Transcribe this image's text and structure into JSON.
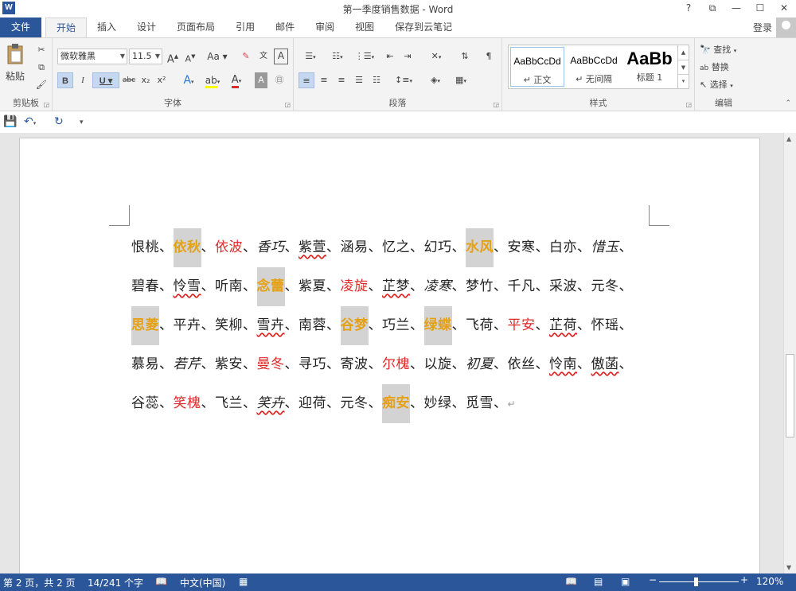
{
  "window": {
    "title": "第一季度销售数据 - Word",
    "controls": [
      "?",
      "⧉",
      "—",
      "☐",
      "✕"
    ]
  },
  "tabs": {
    "file": "文件",
    "items": [
      "开始",
      "插入",
      "设计",
      "页面布局",
      "引用",
      "邮件",
      "审阅",
      "视图",
      "保存到云笔记"
    ],
    "active": "开始",
    "login": "登录"
  },
  "ribbon": {
    "clipboard": {
      "label": "剪贴板",
      "paste": "粘贴"
    },
    "font": {
      "label": "字体",
      "family": "微软雅黑",
      "size": "11.5",
      "grow": "A",
      "shrink": "A",
      "case": "Aa",
      "bold": "B",
      "italic": "I",
      "underline": "U",
      "strike": "abc",
      "sub": "x₂",
      "sup": "x²",
      "highlight_color": "#ffff00",
      "font_color": "#e02a2a"
    },
    "paragraph": {
      "label": "段落"
    },
    "styles": {
      "label": "样式",
      "items": [
        {
          "sample": "AaBbCcDd",
          "name": "↵ 正文"
        },
        {
          "sample": "AaBbCcDd",
          "name": "↵ 无间隔"
        },
        {
          "sample": "AaBb",
          "name": "标题 1"
        }
      ]
    },
    "editing": {
      "label": "编辑",
      "find": "查找",
      "replace": "替换",
      "select": "选择"
    }
  },
  "document": {
    "lines": [
      [
        {
          "t": "恨桃",
          "s": ""
        },
        {
          "t": "、",
          "s": ""
        },
        {
          "t": "依秋",
          "s": "hl"
        },
        {
          "t": "、",
          "s": ""
        },
        {
          "t": "依波",
          "s": "red"
        },
        {
          "t": "、",
          "s": ""
        },
        {
          "t": "香巧",
          "s": "it"
        },
        {
          "t": "、",
          "s": ""
        },
        {
          "t": "紫萱",
          "s": "sq"
        },
        {
          "t": "、",
          "s": ""
        },
        {
          "t": "涵易",
          "s": ""
        },
        {
          "t": "、",
          "s": ""
        },
        {
          "t": "忆之",
          "s": ""
        },
        {
          "t": "、",
          "s": ""
        },
        {
          "t": "幻巧",
          "s": ""
        },
        {
          "t": "、",
          "s": ""
        },
        {
          "t": "水风",
          "s": "hl"
        },
        {
          "t": "、",
          "s": ""
        },
        {
          "t": "安寒",
          "s": ""
        },
        {
          "t": "、",
          "s": ""
        },
        {
          "t": "白亦",
          "s": ""
        },
        {
          "t": "、",
          "s": ""
        },
        {
          "t": "惜玉",
          "s": "it"
        },
        {
          "t": "、",
          "s": ""
        }
      ],
      [
        {
          "t": "碧春",
          "s": ""
        },
        {
          "t": "、",
          "s": ""
        },
        {
          "t": "怜雪",
          "s": "sq"
        },
        {
          "t": "、",
          "s": ""
        },
        {
          "t": "听南",
          "s": ""
        },
        {
          "t": "、",
          "s": ""
        },
        {
          "t": "念蕾",
          "s": "hl"
        },
        {
          "t": "、",
          "s": ""
        },
        {
          "t": "紫夏",
          "s": ""
        },
        {
          "t": "、",
          "s": ""
        },
        {
          "t": "凌旋",
          "s": "red"
        },
        {
          "t": "、",
          "s": ""
        },
        {
          "t": "芷梦",
          "s": "sq"
        },
        {
          "t": "、",
          "s": ""
        },
        {
          "t": "凌寒",
          "s": "it"
        },
        {
          "t": "、",
          "s": ""
        },
        {
          "t": "梦竹",
          "s": ""
        },
        {
          "t": "、",
          "s": ""
        },
        {
          "t": "千凡",
          "s": ""
        },
        {
          "t": "、",
          "s": ""
        },
        {
          "t": "采波",
          "s": ""
        },
        {
          "t": "、",
          "s": ""
        },
        {
          "t": "元冬",
          "s": ""
        },
        {
          "t": "、",
          "s": ""
        }
      ],
      [
        {
          "t": "思菱",
          "s": "hl"
        },
        {
          "t": "、",
          "s": ""
        },
        {
          "t": "平卉",
          "s": ""
        },
        {
          "t": "、",
          "s": ""
        },
        {
          "t": "笑柳",
          "s": ""
        },
        {
          "t": "、",
          "s": ""
        },
        {
          "t": "雪卉",
          "s": "sq"
        },
        {
          "t": "、",
          "s": ""
        },
        {
          "t": "南蓉",
          "s": ""
        },
        {
          "t": "、",
          "s": ""
        },
        {
          "t": "谷梦",
          "s": "hl"
        },
        {
          "t": "、",
          "s": ""
        },
        {
          "t": "巧兰",
          "s": ""
        },
        {
          "t": "、",
          "s": ""
        },
        {
          "t": "绿蝶",
          "s": "hl"
        },
        {
          "t": "、",
          "s": ""
        },
        {
          "t": "飞荷",
          "s": ""
        },
        {
          "t": "、",
          "s": ""
        },
        {
          "t": "平安",
          "s": "red"
        },
        {
          "t": "、",
          "s": ""
        },
        {
          "t": "芷荷",
          "s": "sq"
        },
        {
          "t": "、",
          "s": ""
        },
        {
          "t": "怀瑶",
          "s": ""
        },
        {
          "t": "、",
          "s": ""
        }
      ],
      [
        {
          "t": "慕易",
          "s": ""
        },
        {
          "t": "、",
          "s": ""
        },
        {
          "t": "若芹",
          "s": "it"
        },
        {
          "t": "、",
          "s": ""
        },
        {
          "t": "紫安",
          "s": ""
        },
        {
          "t": "、",
          "s": ""
        },
        {
          "t": "曼冬",
          "s": "red"
        },
        {
          "t": "、",
          "s": ""
        },
        {
          "t": "寻巧",
          "s": ""
        },
        {
          "t": "、",
          "s": ""
        },
        {
          "t": "寄波",
          "s": ""
        },
        {
          "t": "、",
          "s": ""
        },
        {
          "t": "尔槐",
          "s": "red"
        },
        {
          "t": "、",
          "s": ""
        },
        {
          "t": "以旋",
          "s": ""
        },
        {
          "t": "、",
          "s": ""
        },
        {
          "t": "初夏",
          "s": "it"
        },
        {
          "t": "、",
          "s": ""
        },
        {
          "t": "依丝",
          "s": ""
        },
        {
          "t": "、",
          "s": ""
        },
        {
          "t": "怜南",
          "s": "sq"
        },
        {
          "t": "、",
          "s": ""
        },
        {
          "t": "傲菡",
          "s": "sq"
        },
        {
          "t": "、",
          "s": ""
        }
      ],
      [
        {
          "t": "谷蕊",
          "s": ""
        },
        {
          "t": "、",
          "s": ""
        },
        {
          "t": "笑槐",
          "s": "red"
        },
        {
          "t": "、",
          "s": ""
        },
        {
          "t": "飞兰",
          "s": ""
        },
        {
          "t": "、",
          "s": ""
        },
        {
          "t": "笑卉",
          "s": "it sq"
        },
        {
          "t": "、",
          "s": ""
        },
        {
          "t": "迎荷",
          "s": ""
        },
        {
          "t": "、",
          "s": ""
        },
        {
          "t": "元冬",
          "s": ""
        },
        {
          "t": "、",
          "s": ""
        },
        {
          "t": "痴安",
          "s": "hl"
        },
        {
          "t": "、",
          "s": ""
        },
        {
          "t": "妙绿",
          "s": ""
        },
        {
          "t": "、",
          "s": ""
        },
        {
          "t": "觅雪",
          "s": ""
        },
        {
          "t": "、",
          "s": ""
        }
      ]
    ],
    "paragraph_mark": "↵"
  },
  "statusbar": {
    "page": "第 2 页，共 2 页",
    "words": "14/241 个字",
    "language": "中文(中国)",
    "zoom": "120%",
    "zoom_minus": "−",
    "zoom_plus": "+"
  }
}
